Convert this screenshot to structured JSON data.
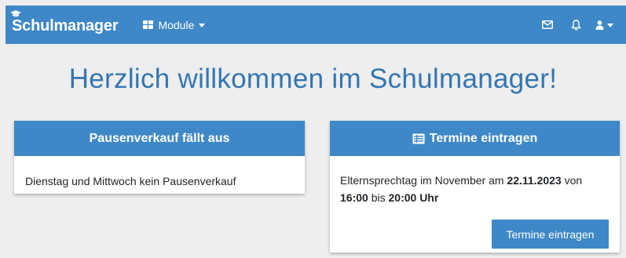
{
  "navbar": {
    "brand": "Schulmanager",
    "module_label": "Module",
    "icons": [
      "mail-icon",
      "bell-icon",
      "user-icon"
    ]
  },
  "page": {
    "title": "Herzlich willkommen im Schulmanager!"
  },
  "cards": {
    "pause": {
      "title": "Pausenverkauf fällt aus",
      "text": "Dienstag und Mittwoch kein Pausenverkauf"
    },
    "termine": {
      "title": "Termine eintragen",
      "text_1": "Elternsprechtag im November am ",
      "date": "22.11.2023",
      "text_2": " von",
      "time_start": "16:00",
      "text_3": " bis ",
      "time_end": "20:00 Uhr",
      "button_label": "Termine eintragen"
    }
  },
  "colors": {
    "primary": "#3e88c7",
    "title": "#3476b1",
    "background": "#eeeeee"
  }
}
